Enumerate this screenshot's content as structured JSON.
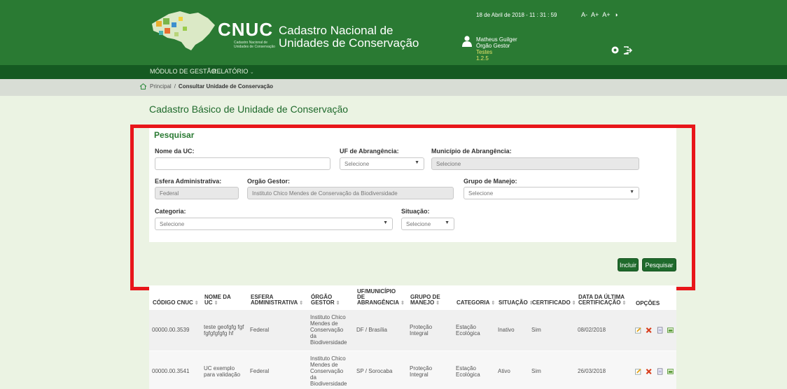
{
  "header": {
    "brand": "CNUC",
    "brand_sub": "Cadastro Nacional de Unidades de Conservação",
    "title_line1": "Cadastro Nacional de",
    "title_line2": "Unidades de Conservação",
    "datetime": "18 de Abril de 2018 - 11 : 31 : 59",
    "font_controls": [
      "A-",
      "A+",
      "A+"
    ],
    "user": {
      "name": "Matheus Guilger",
      "role": "Órgão Gestor",
      "org": "Testes",
      "version": "1.2.5"
    }
  },
  "menu": {
    "items": [
      {
        "label": "MÓDULO DE GESTÃO"
      },
      {
        "label": "RELATÓRIO"
      }
    ]
  },
  "breadcrumb": {
    "home": "Principal",
    "separator": "/",
    "current": "Consultar Unidade de Conservação"
  },
  "page": {
    "title": "Cadastro Básico de Unidade de Conservação"
  },
  "search": {
    "title": "Pesquisar",
    "nome_label": "Nome da UC:",
    "nome_value": "",
    "uf_label": "UF de Abrangência:",
    "uf_value": "Selecione",
    "municipio_label": "Município de Abrangência:",
    "municipio_value": "Selecione",
    "esfera_label": "Esfera Administrativa:",
    "esfera_value": "Federal",
    "orgao_label": "Orgão Gestor:",
    "orgao_value": "Instituto Chico Mendes de Conservação da Biodiversidade",
    "grupo_label": "Grupo de Manejo:",
    "grupo_value": "Selecione",
    "categoria_label": "Categoria:",
    "categoria_value": "Selecione",
    "situacao_label": "Situação:",
    "situacao_value": "Selecione",
    "incluir_label": "Incluir",
    "pesquisar_label": "Pesquisar"
  },
  "table": {
    "headers": {
      "codigo": "CÓDIGO CNUC",
      "nome": "NOME DA UC",
      "esfera": "ESFERA ADMINISTRATIVA",
      "orgao": "ÓRGÃO GESTOR",
      "uf": "UF/MUNICÍPIO DE ABRANGÊNCIA",
      "grupo": "GRUPO DE MANEJO",
      "categoria": "CATEGORIA",
      "situacao": "SITUAÇÃO",
      "certificado": "CERTIFICADO",
      "data": "DATA DA ÚLTIMA CERTIFICAÇÃO",
      "opcoes": "OPÇÕES"
    },
    "rows": [
      {
        "codigo": "00000.00.3539",
        "nome": "teste geofgfg fgf fgfgfgfgfg hf",
        "esfera": "Federal",
        "orgao": "Instituto Chico Mendes de Conservação da Biodiversidade",
        "uf": "DF / Brasília",
        "grupo": "Proteção Integral",
        "categoria": "Estação Ecológica",
        "situacao": "Inativo",
        "certificado": "Sim",
        "data": "08/02/2018"
      },
      {
        "codigo": "00000.00.3541",
        "nome": "UC exemplo para validação",
        "esfera": "Federal",
        "orgao": "Instituto Chico Mendes de Conservação da Biodiversidade",
        "uf": "SP / Sorocaba",
        "grupo": "Proteção Integral",
        "categoria": "Estação Ecológica",
        "situacao": "Ativo",
        "certificado": "Sim",
        "data": "26/03/2018"
      }
    ]
  },
  "colors": {
    "header_green": "#2a7a33",
    "menu_green": "#155a22",
    "highlight_red": "#e8161a"
  }
}
